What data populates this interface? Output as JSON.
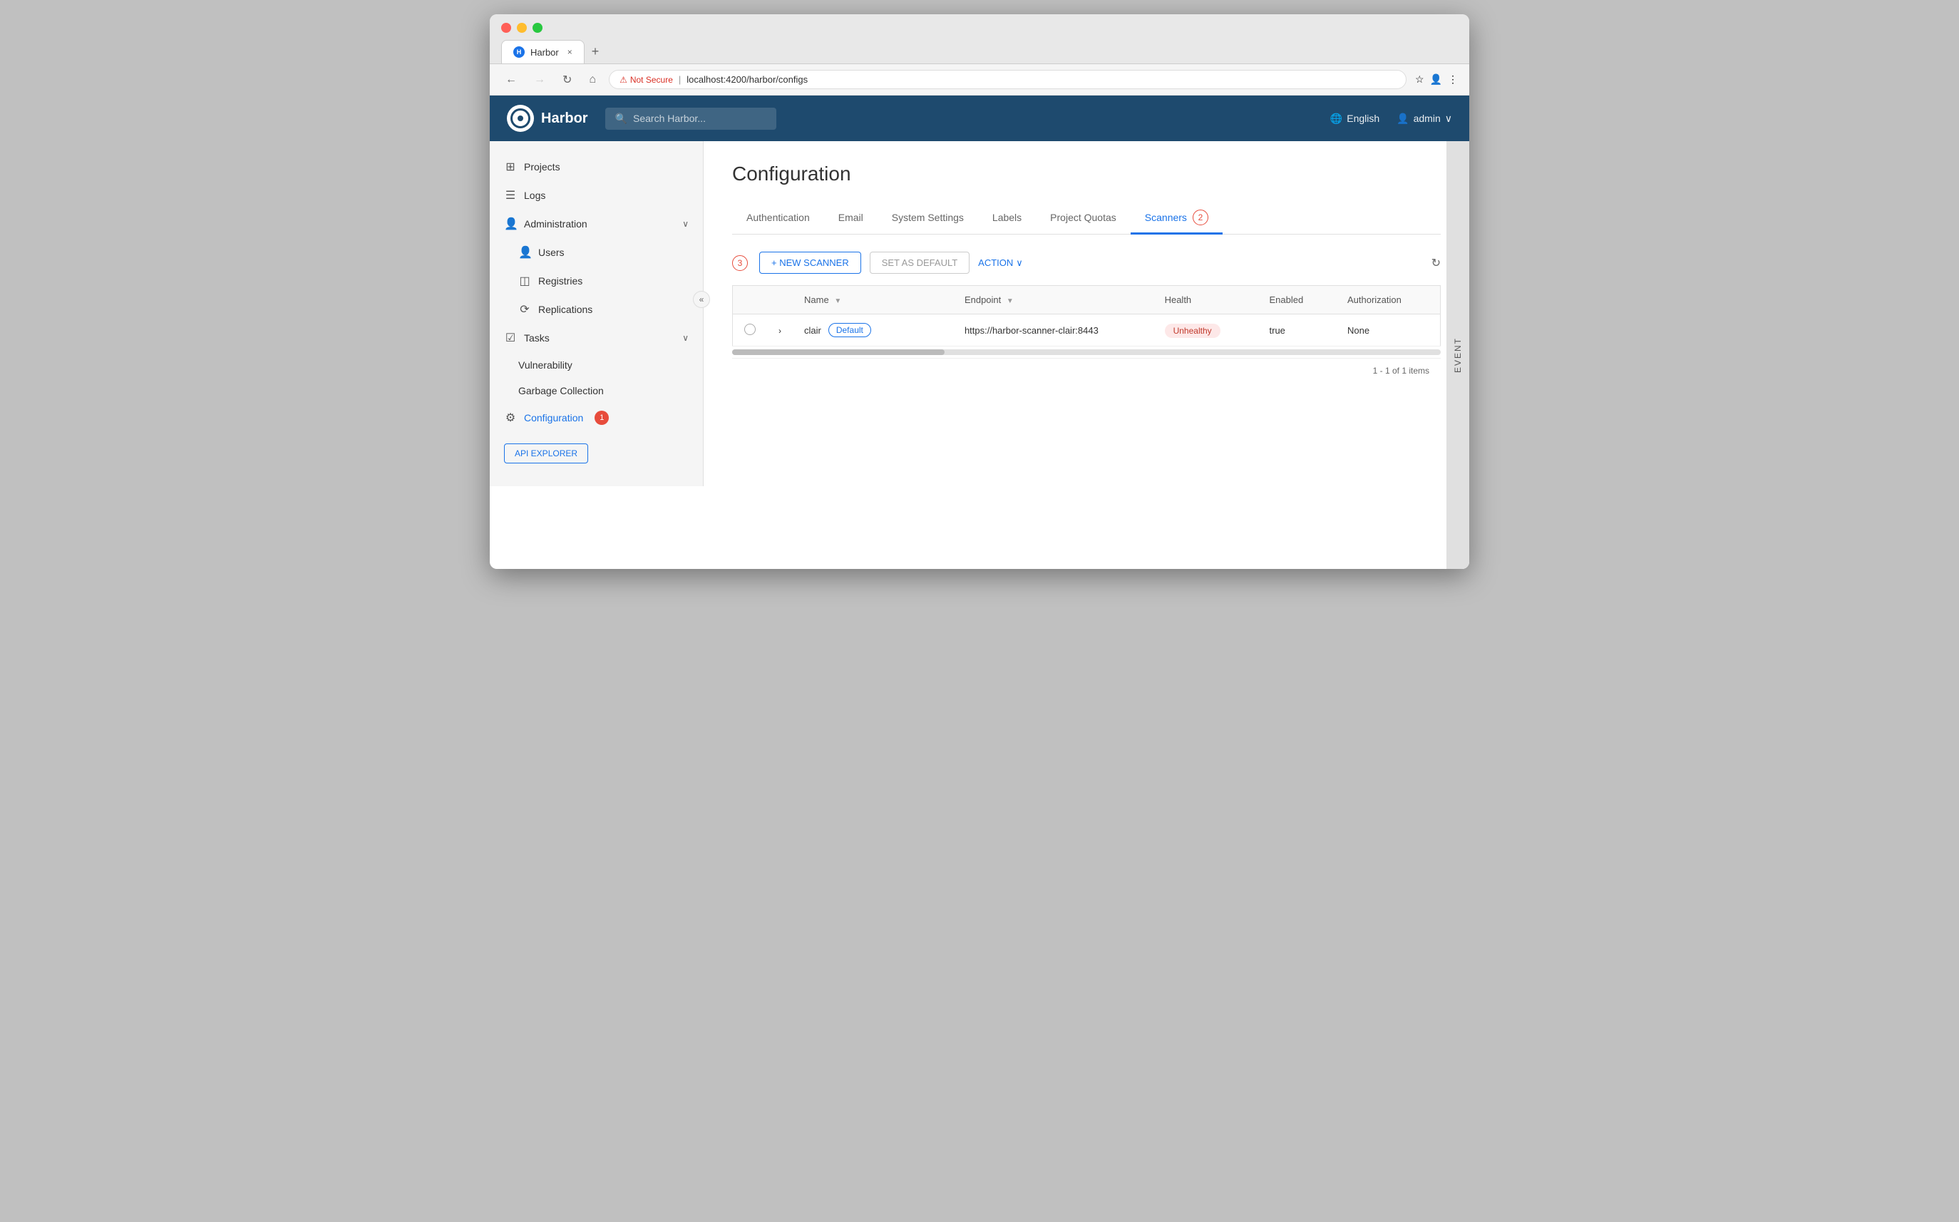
{
  "browser": {
    "tab_title": "Harbor",
    "tab_close": "×",
    "tab_new": "+",
    "nav_back": "←",
    "nav_forward": "→",
    "nav_refresh": "↻",
    "nav_home": "⌂",
    "not_secure_label": "Not Secure",
    "address": "localhost:4200/harbor/configs",
    "bookmark_icon": "☆",
    "profile_icon": "👤",
    "menu_icon": "⋮"
  },
  "topnav": {
    "app_name": "Harbor",
    "search_placeholder": "Search Harbor...",
    "language": "English",
    "user": "admin",
    "user_caret": "∨"
  },
  "sidebar": {
    "collapse_icon": "«",
    "items": [
      {
        "id": "projects",
        "label": "Projects",
        "icon": "⊞"
      },
      {
        "id": "logs",
        "label": "Logs",
        "icon": "☰"
      }
    ],
    "administration": {
      "label": "Administration",
      "icon": "👤",
      "chevron": "∨",
      "children": [
        {
          "id": "users",
          "label": "Users",
          "icon": "👤"
        },
        {
          "id": "registries",
          "label": "Registries",
          "icon": "◫"
        },
        {
          "id": "replications",
          "label": "Replications",
          "icon": "⟳"
        }
      ]
    },
    "tasks": {
      "label": "Tasks",
      "icon": "☑",
      "chevron": "∨",
      "children": [
        {
          "id": "vulnerability",
          "label": "Vulnerability"
        },
        {
          "id": "garbage-collection",
          "label": "Garbage Collection"
        }
      ]
    },
    "configuration": {
      "label": "Configuration",
      "icon": "⚙",
      "badge": "1"
    },
    "api_explorer": "API EXPLORER"
  },
  "page": {
    "title": "Configuration",
    "tabs": [
      {
        "id": "authentication",
        "label": "Authentication",
        "active": false
      },
      {
        "id": "email",
        "label": "Email",
        "active": false
      },
      {
        "id": "system-settings",
        "label": "System Settings",
        "active": false
      },
      {
        "id": "labels",
        "label": "Labels",
        "active": false
      },
      {
        "id": "project-quotas",
        "label": "Project Quotas",
        "active": false
      },
      {
        "id": "scanners",
        "label": "Scanners",
        "active": true,
        "badge": "2"
      }
    ]
  },
  "toolbar": {
    "circle_badge": "3",
    "new_scanner": "+ NEW SCANNER",
    "set_as_default": "SET AS DEFAULT",
    "action": "ACTION",
    "action_caret": "∨",
    "refresh_icon": "↻"
  },
  "table": {
    "columns": [
      {
        "id": "checkbox",
        "label": ""
      },
      {
        "id": "expand",
        "label": ""
      },
      {
        "id": "name",
        "label": "Name"
      },
      {
        "id": "endpoint",
        "label": "Endpoint"
      },
      {
        "id": "health",
        "label": "Health"
      },
      {
        "id": "enabled",
        "label": "Enabled"
      },
      {
        "id": "authorization",
        "label": "Authorization"
      }
    ],
    "rows": [
      {
        "name": "clair",
        "default_badge": "Default",
        "endpoint": "https://harbor-scanner-clair:8443",
        "health": "Unhealthy",
        "enabled": "true",
        "authorization": "None"
      }
    ],
    "pagination": "1 - 1 of 1 items"
  },
  "event_panel": {
    "label": "EVENT"
  }
}
